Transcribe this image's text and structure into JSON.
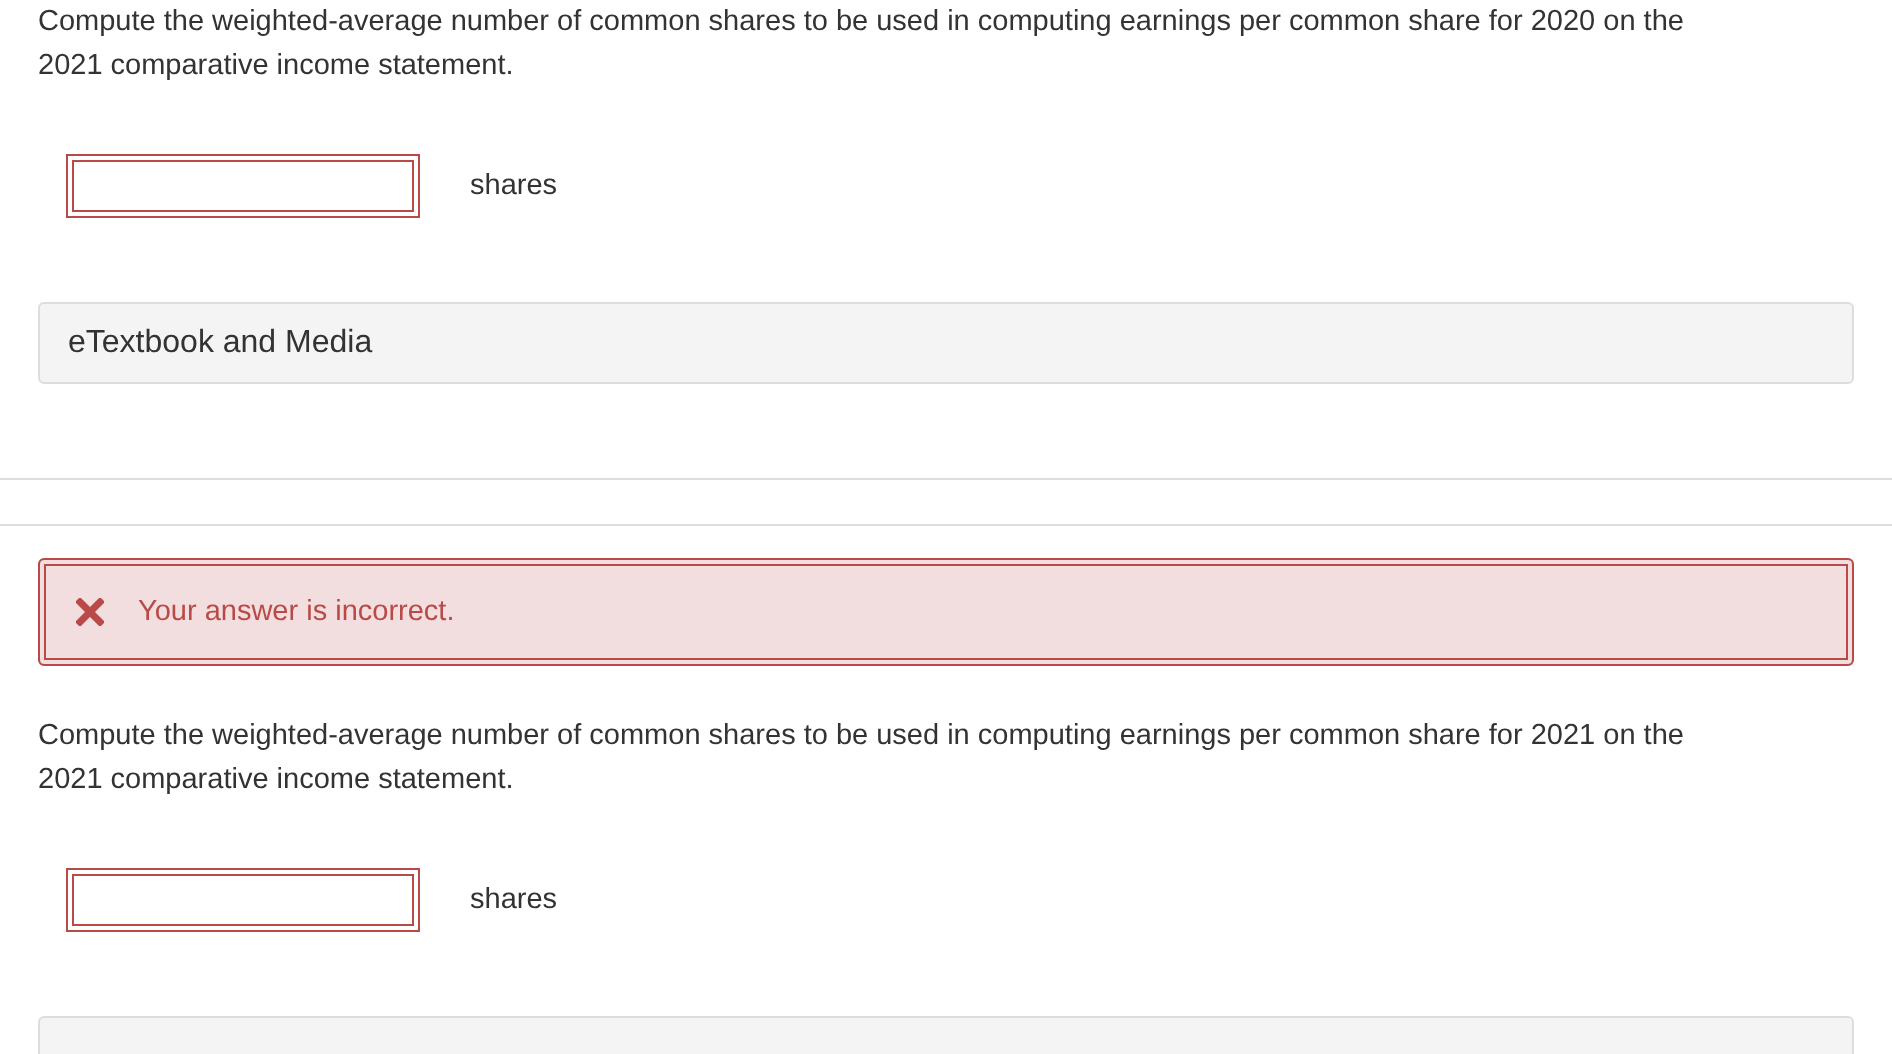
{
  "parts": [
    {
      "prompt": "Compute the weighted-average number of common shares to be used in computing earnings per common share for 2020 on the 2021 comparative income statement.",
      "answer": {
        "incorrect": true,
        "unit": "shares"
      },
      "resource": "eTextbook and Media"
    },
    {
      "feedback": {
        "kind": "error",
        "text": "Your answer is incorrect."
      },
      "prompt": "Compute the weighted-average number of common shares to be used in computing earnings per common share for 2021 on the 2021 comparative income statement.",
      "answer": {
        "incorrect": true,
        "unit": "shares"
      }
    }
  ]
}
